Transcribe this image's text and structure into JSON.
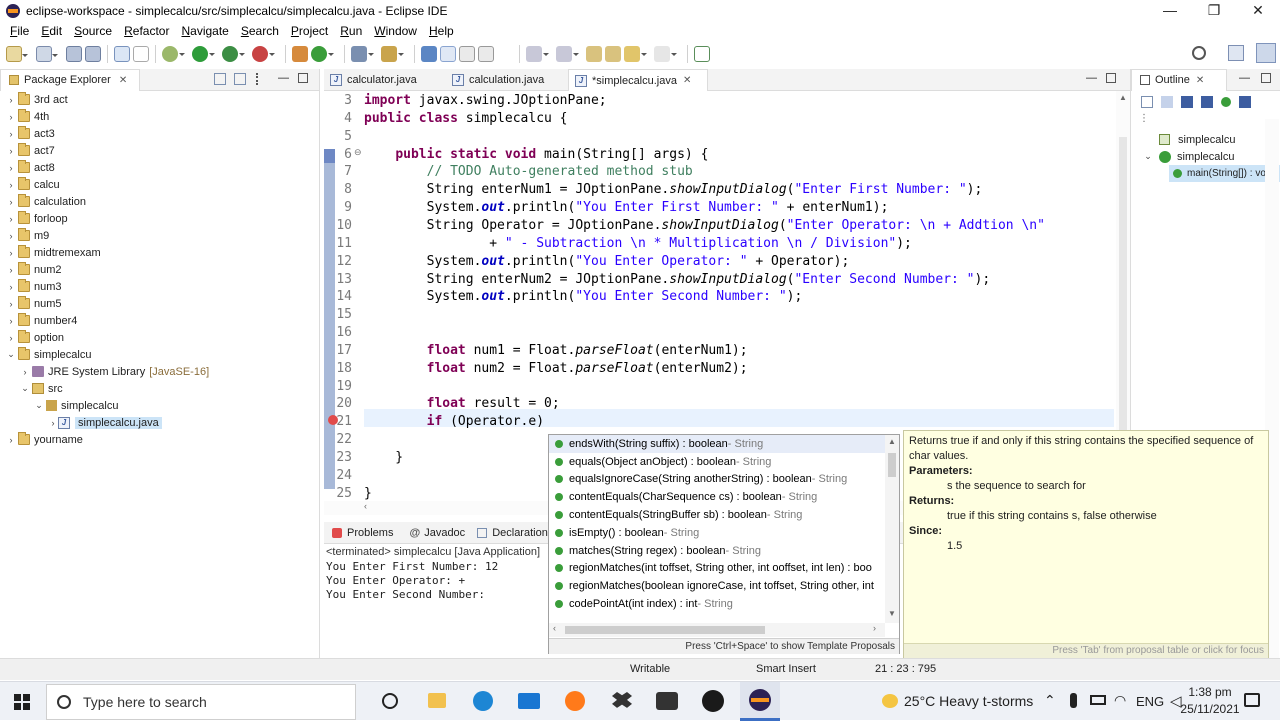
{
  "window": {
    "title": "eclipse-workspace - simplecalcu/src/simplecalcu/simplecalcu.java - Eclipse IDE",
    "minimize": "—",
    "restore": "❐",
    "close": "✕"
  },
  "menu": [
    "File",
    "Edit",
    "Source",
    "Refactor",
    "Navigate",
    "Search",
    "Project",
    "Run",
    "Window",
    "Help"
  ],
  "package_explorer": {
    "title": "Package Explorer",
    "items": [
      {
        "label": "3rd act",
        "level": 0,
        "arrow": "›"
      },
      {
        "label": "4th",
        "level": 0,
        "arrow": "›"
      },
      {
        "label": "act3",
        "level": 0,
        "arrow": "›"
      },
      {
        "label": "act7",
        "level": 0,
        "arrow": "›"
      },
      {
        "label": "act8",
        "level": 0,
        "arrow": "›"
      },
      {
        "label": "calcu",
        "level": 0,
        "arrow": "›"
      },
      {
        "label": "calculation",
        "level": 0,
        "arrow": "›"
      },
      {
        "label": "forloop",
        "level": 0,
        "arrow": "›"
      },
      {
        "label": "m9",
        "level": 0,
        "arrow": "›"
      },
      {
        "label": "midtremexam",
        "level": 0,
        "arrow": "›"
      },
      {
        "label": "num2",
        "level": 0,
        "arrow": "›"
      },
      {
        "label": "num3",
        "level": 0,
        "arrow": "›"
      },
      {
        "label": "num5",
        "level": 0,
        "arrow": "›"
      },
      {
        "label": "number4",
        "level": 0,
        "arrow": "›"
      },
      {
        "label": "option",
        "level": 0,
        "arrow": "›"
      },
      {
        "label": "simplecalcu",
        "level": 0,
        "arrow": "⌄"
      },
      {
        "label": "JRE System Library",
        "suffix": "[JavaSE-16]",
        "level": 1,
        "arrow": "›"
      },
      {
        "label": "src",
        "level": 1,
        "arrow": "⌄"
      },
      {
        "label": "simplecalcu",
        "level": 2,
        "arrow": "⌄"
      },
      {
        "label": "simplecalcu.java",
        "level": 3,
        "arrow": "›",
        "selected": true
      },
      {
        "label": "yourname",
        "level": 0,
        "arrow": "›"
      }
    ]
  },
  "editor": {
    "tabs": [
      {
        "label": "calculator.java"
      },
      {
        "label": "calculation.java"
      },
      {
        "label": "*simplecalcu.java",
        "active": true
      }
    ],
    "lines": [
      {
        "n": "3",
        "html": "<span class=\"kw\">import</span> javax.swing.JOptionPane;"
      },
      {
        "n": "4",
        "html": "<span class=\"kw\">public class</span> simplecalcu {"
      },
      {
        "n": "5",
        "html": ""
      },
      {
        "n": "6",
        "html": "    <span class=\"kw\">public static void</span> main(String[] args) {"
      },
      {
        "n": "7",
        "html": "        <span class=\"cm\">// TODO Auto-generated method stub</span>"
      },
      {
        "n": "8",
        "html": "        String enterNum1 = JOptionPane.<span class=\"it\">showInputDialog</span>(<span class=\"str\">\"Enter First Number: \"</span>);"
      },
      {
        "n": "9",
        "html": "        System.<span class=\"fld\">out</span>.println(<span class=\"str\">\"You Enter First Number: \"</span> + enterNum1);"
      },
      {
        "n": "10",
        "html": "        String Operator = JOptionPane.<span class=\"it\">showInputDialog</span>(<span class=\"str\">\"Enter Operator: \\n + Addtion \\n\"</span>"
      },
      {
        "n": "11",
        "html": "                + <span class=\"str\">\" - Subtraction \\n * Multiplication \\n / Division\"</span>);"
      },
      {
        "n": "12",
        "html": "        System.<span class=\"fld\">out</span>.println(<span class=\"str\">\"You Enter Operator: \"</span> + Operator);"
      },
      {
        "n": "13",
        "html": "        String enterNum2 = JOptionPane.<span class=\"it\">showInputDialog</span>(<span class=\"str\">\"Enter Second Number: \"</span>);"
      },
      {
        "n": "14",
        "html": "        System.<span class=\"fld\">out</span>.println(<span class=\"str\">\"You Enter Second Number: \"</span>);"
      },
      {
        "n": "15",
        "html": ""
      },
      {
        "n": "16",
        "html": ""
      },
      {
        "n": "17",
        "html": "        <span class=\"kw\">float</span> num1 = Float.<span class=\"it\">parseFloat</span>(enterNum1);"
      },
      {
        "n": "18",
        "html": "        <span class=\"kw\">float</span> num2 = Float.<span class=\"it\">parseFloat</span>(enterNum2);"
      },
      {
        "n": "19",
        "html": ""
      },
      {
        "n": "20",
        "html": "        <span class=\"kw\">float</span> result = 0;"
      },
      {
        "n": "21",
        "html": "        <span class=\"kw\">if</span> (Operator.e)"
      },
      {
        "n": "22",
        "html": ""
      },
      {
        "n": "23",
        "html": "    }"
      },
      {
        "n": "24",
        "html": ""
      },
      {
        "n": "25",
        "html": "}"
      }
    ]
  },
  "outline": {
    "title": "Outline",
    "items": [
      {
        "label": "simplecalcu",
        "level": 0
      },
      {
        "label": "simplecalcu",
        "level": 0,
        "arrow": "⌄"
      },
      {
        "label": "main(String[]) : vo",
        "level": 1
      }
    ]
  },
  "console": {
    "tabs": [
      "Problems",
      "Javadoc",
      "Declaration"
    ],
    "header": "<terminated> simplecalcu [Java Application]",
    "lines": [
      "You Enter First Number: 12",
      "You Enter Operator: +",
      "You Enter Second Number:"
    ]
  },
  "completion": {
    "items": [
      {
        "sig": "endsWith(String suffix) : boolean",
        "cls": " - String",
        "selected": true
      },
      {
        "sig": "equals(Object anObject) : boolean",
        "cls": " - String"
      },
      {
        "sig": "equalsIgnoreCase(String anotherString) : boolean",
        "cls": " - String"
      },
      {
        "sig": "contentEquals(CharSequence cs) : boolean",
        "cls": " - String"
      },
      {
        "sig": "contentEquals(StringBuffer sb) : boolean",
        "cls": " - String"
      },
      {
        "sig": "isEmpty() : boolean",
        "cls": " - String"
      },
      {
        "sig": "matches(String regex) : boolean",
        "cls": " - String"
      },
      {
        "sig": "regionMatches(int toffset, String other, int ooffset, int len) : boo",
        "cls": ""
      },
      {
        "sig": "regionMatches(boolean ignoreCase, int toffset, String other, int",
        "cls": ""
      },
      {
        "sig": "codePointAt(int index) : int",
        "cls": " - String"
      }
    ],
    "footer": "Press 'Ctrl+Space' to show Template Proposals"
  },
  "doc": {
    "summary": "Returns true if and only if this string contains the specified sequence of char values.",
    "params_label": "Parameters:",
    "param": "s the sequence to search for",
    "returns_label": "Returns:",
    "returns": "true if this string contains s, false otherwise",
    "since_label": "Since:",
    "since": "1.5",
    "footer": "Press 'Tab' from proposal table or click for focus"
  },
  "status": {
    "writable": "Writable",
    "insert": "Smart Insert",
    "position": "21 : 23 : 795"
  },
  "taskbar": {
    "search_placeholder": "Type here to search",
    "weather": "25°C  Heavy t-storms",
    "lang": "ENG",
    "time": "1:38 pm",
    "date": "25/11/2021"
  }
}
